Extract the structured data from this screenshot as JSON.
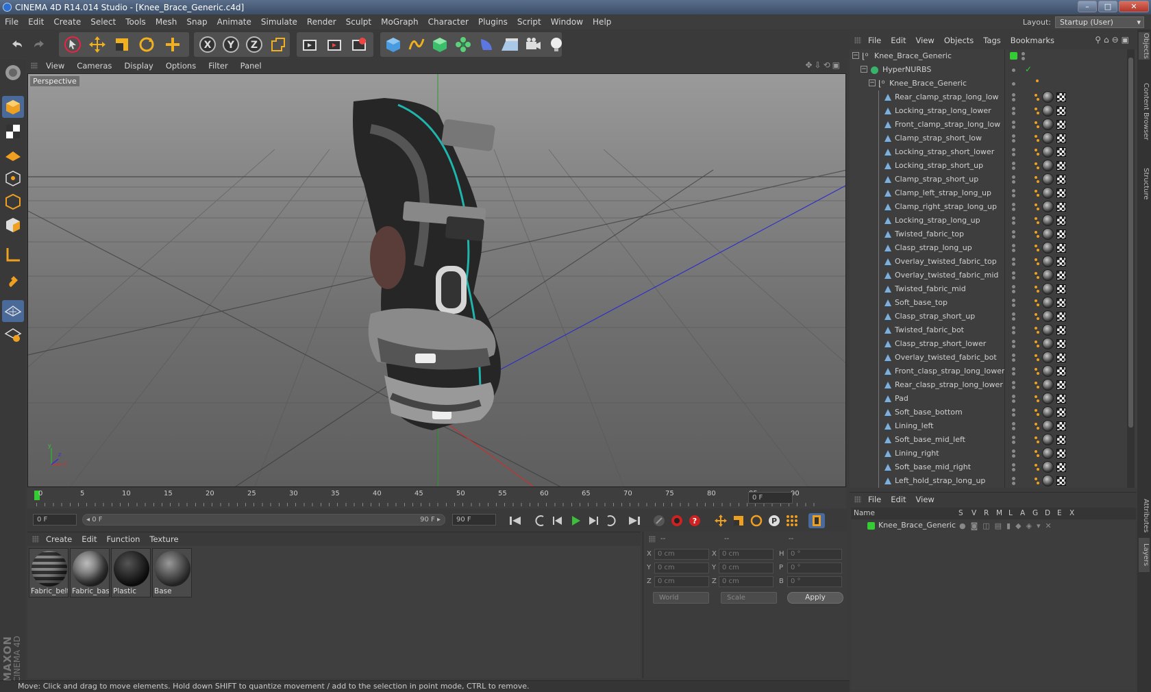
{
  "window": {
    "title": "CINEMA 4D R14.014 Studio - [Knee_Brace_Generic.c4d]",
    "minimize": "–",
    "maximize": "□",
    "close": "✕"
  },
  "menubar": [
    "File",
    "Edit",
    "Create",
    "Select",
    "Tools",
    "Mesh",
    "Snap",
    "Animate",
    "Simulate",
    "Render",
    "Sculpt",
    "MoGraph",
    "Character",
    "Plugins",
    "Script",
    "Window",
    "Help"
  ],
  "layout": {
    "label": "Layout:",
    "value": "Startup (User)"
  },
  "toolbar_icons": [
    "undo-icon",
    "redo-icon",
    "live-selection-icon",
    "move-icon",
    "scale-icon",
    "rotate-icon",
    "add-icon",
    "x-axis-icon",
    "y-axis-icon",
    "z-axis-icon",
    "coordinate-system-icon",
    "render-view-icon",
    "render-picture-viewer-icon",
    "edit-render-settings-icon",
    "cube-icon",
    "spline-pen-icon",
    "subdivision-icon",
    "array-icon",
    "deformer-icon",
    "floor-icon",
    "camera-icon",
    "light-icon"
  ],
  "viewport": {
    "menu": [
      "View",
      "Cameras",
      "Display",
      "Options",
      "Filter",
      "Panel"
    ],
    "label": "Perspective",
    "axis": {
      "y": "y",
      "z": "z",
      "x": "x"
    }
  },
  "timeline": {
    "ticks": [
      "0",
      "5",
      "10",
      "15",
      "20",
      "25",
      "30",
      "35",
      "40",
      "45",
      "50",
      "55",
      "60",
      "65",
      "70",
      "75",
      "80",
      "85",
      "90"
    ],
    "current_frame": "0 F"
  },
  "anim": {
    "start": "0 F",
    "range_start": "◂ 0 F",
    "range_end": "90 F ▸",
    "end": "90 F"
  },
  "materials": {
    "menu": [
      "Create",
      "Edit",
      "Function",
      "Texture"
    ],
    "items": [
      {
        "label": "Fabric_belt"
      },
      {
        "label": "Fabric_basi"
      },
      {
        "label": "Plastic"
      },
      {
        "label": "Base"
      }
    ]
  },
  "coords": {
    "head": [
      "--",
      "--",
      "--"
    ],
    "rows": [
      {
        "a": "X",
        "v1": "0 cm",
        "b": "X",
        "v2": "0 cm",
        "c": "H",
        "v3": "0 °"
      },
      {
        "a": "Y",
        "v1": "0 cm",
        "b": "Y",
        "v2": "0 cm",
        "c": "P",
        "v3": "0 °"
      },
      {
        "a": "Z",
        "v1": "0 cm",
        "b": "Z",
        "v2": "0 cm",
        "c": "B",
        "v3": "0 °"
      }
    ],
    "mode": "World",
    "scale": "Scale",
    "apply": "Apply"
  },
  "status": "Move: Click and drag to move elements. Hold down SHIFT to quantize movement / add to the selection in point mode, CTRL to remove.",
  "objects": {
    "menu": [
      "File",
      "Edit",
      "View",
      "Objects",
      "Tags",
      "Bookmarks"
    ],
    "root": "Knee_Brace_Generic",
    "hypernurbs": "HyperNURBS",
    "group": "Knee_Brace_Generic",
    "children": [
      "Rear_clamp_strap_long_low",
      "Locking_strap_long_lower",
      "Front_clamp_strap_long_low",
      "Clamp_strap_short_low",
      "Locking_strap_short_lower",
      "Locking_strap_short_up",
      "Clamp_strap_short_up",
      "Clamp_left_strap_long_up",
      "Clamp_right_strap_long_up",
      "Locking_strap_long_up",
      "Twisted_fabric_top",
      "Clasp_strap_long_up",
      "Overlay_twisted_fabric_top",
      "Overlay_twisted_fabric_mid",
      "Twisted_fabric_mid",
      "Soft_base_top",
      "Clasp_strap_short_up",
      "Twisted_fabric_bot",
      "Clasp_strap_short_lower",
      "Overlay_twisted_fabric_bot",
      "Front_clasp_strap_long_lower",
      "Rear_clasp_strap_long_lower",
      "Pad",
      "Soft_base_bottom",
      "Lining_left",
      "Soft_base_mid_left",
      "Lining_right",
      "Soft_base_mid_right",
      "Left_hold_strap_long_up"
    ]
  },
  "layers": {
    "menu": [
      "File",
      "Edit",
      "View"
    ],
    "columns": [
      "Name",
      "S",
      "V",
      "R",
      "M",
      "L",
      "A",
      "G",
      "D",
      "E",
      "X"
    ],
    "row": "Knee_Brace_Generic"
  },
  "sidetabs": [
    "Objects",
    "Content Browser",
    "Structure",
    "Attributes",
    "Layers"
  ],
  "branding": {
    "maxon": "MAXON",
    "cinema": "CINEMA 4D"
  },
  "colors": {
    "accent_orange": "#f0a020",
    "green": "#3ccc3c",
    "selection": "#4a6a9a"
  }
}
